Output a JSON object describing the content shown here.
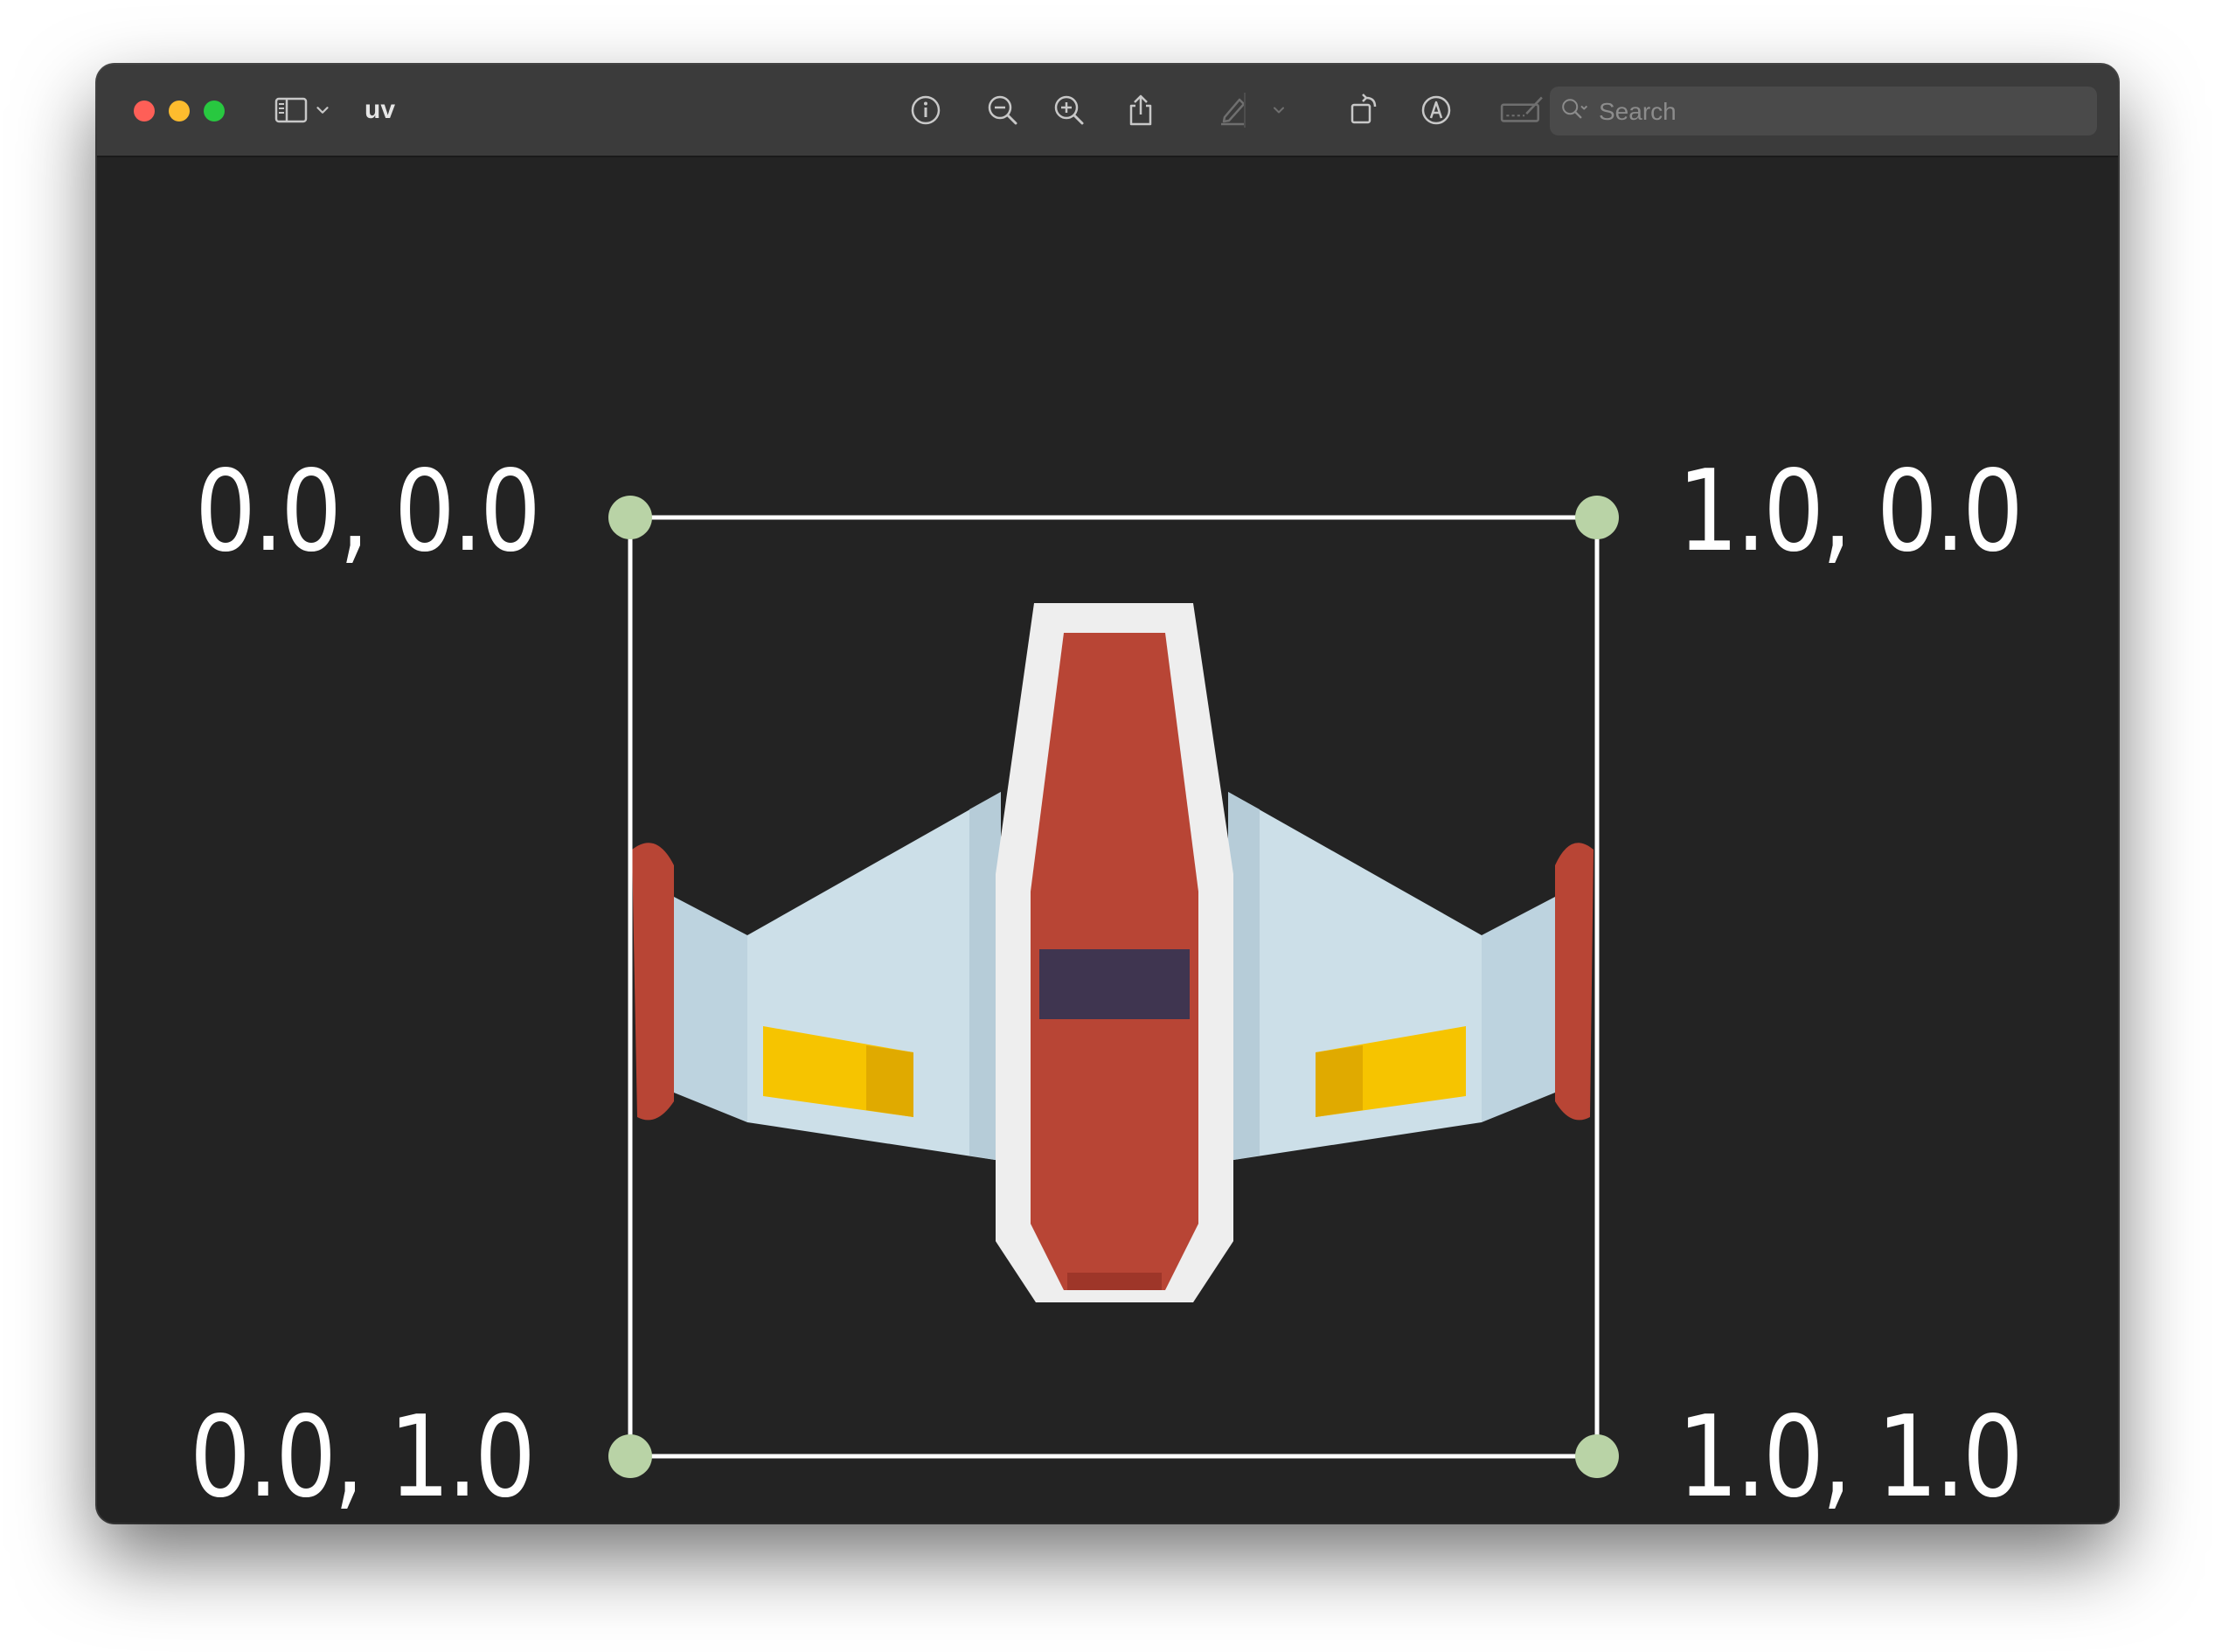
{
  "window": {
    "title": "uv",
    "search_placeholder": "Search"
  },
  "toolbar": {
    "icons": [
      "sidebar-toggle-icon",
      "chevron-down-icon",
      "info-icon",
      "zoom-out-icon",
      "zoom-in-icon",
      "share-icon",
      "highlight-pen-icon",
      "chevron-down-icon",
      "rotate-icon",
      "markup-icon",
      "signature-icon",
      "search-icon"
    ]
  },
  "diagram": {
    "corner_labels": {
      "top_left": "0.0, 0.0",
      "top_right": "1.0, 0.0",
      "bottom_left": "0.0, 1.0",
      "bottom_right": "1.0, 1.0"
    },
    "colors": {
      "background": "#232323",
      "frame": "#ffffff",
      "corner_dot": "#b9d3a6",
      "ship_hull": "#b84535",
      "ship_wing": "#c8dce6",
      "ship_cockpit": "#3f3550",
      "ship_trim": "#eeeeee",
      "ship_thruster": "#f6c400"
    }
  }
}
